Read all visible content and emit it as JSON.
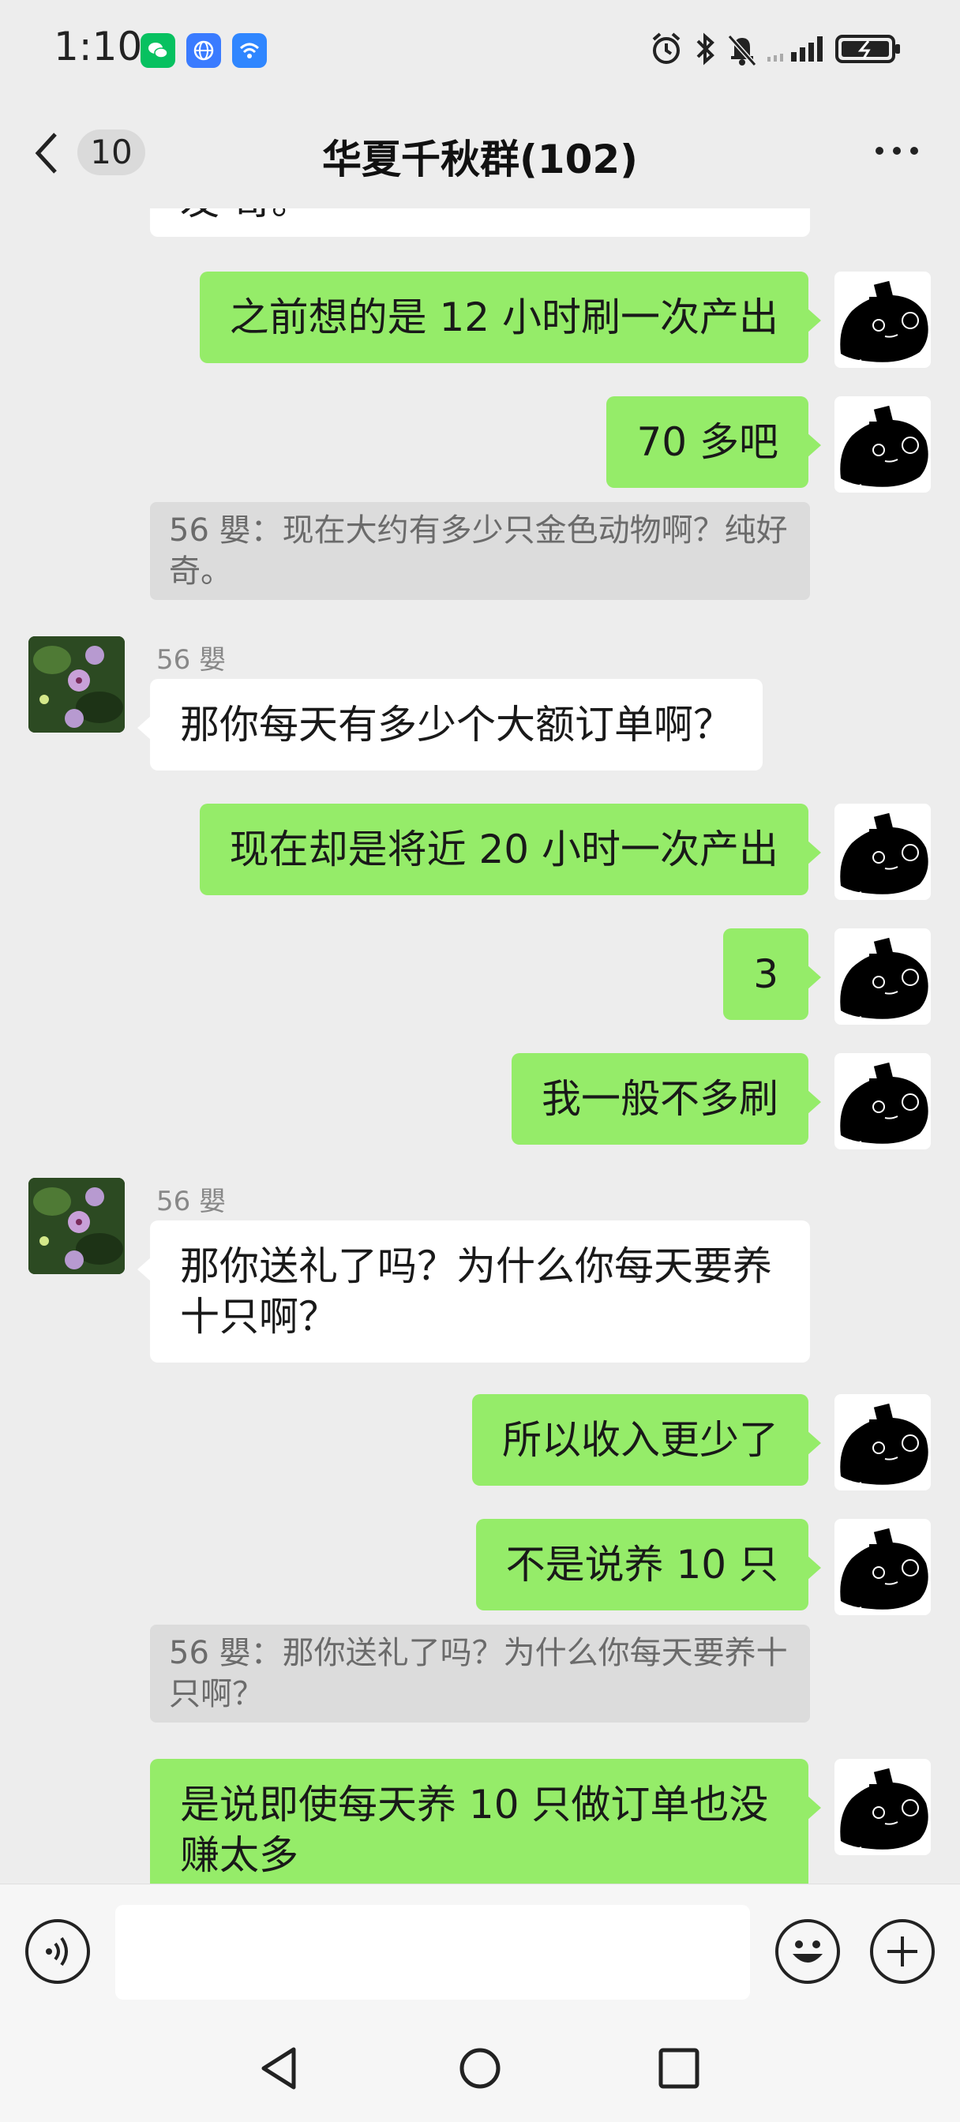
{
  "status_bar": {
    "time": "1:10"
  },
  "header": {
    "back_count": "10",
    "title": "华夏千秋群(102)"
  },
  "messages": [
    {
      "type": "other",
      "text": "发 哥。"
    },
    {
      "type": "me",
      "text": "之前想的是 12 小时刷一次产出"
    },
    {
      "type": "me",
      "text": "70 多吧"
    },
    {
      "type": "quote",
      "text": "56 嬰：现在大约有多少只金色动物啊？纯好奇。"
    },
    {
      "type": "other",
      "sender": "56 嬰",
      "text": "那你每天有多少个大额订单啊？"
    },
    {
      "type": "me",
      "text": "现在却是将近 20 小时一次产出"
    },
    {
      "type": "me",
      "text": "3"
    },
    {
      "type": "me",
      "text": "我一般不多刷"
    },
    {
      "type": "other",
      "sender": "56 嬰",
      "text": "那你送礼了吗？为什么你每天要养十只啊？"
    },
    {
      "type": "me",
      "text": "所以收入更少了"
    },
    {
      "type": "me",
      "text": "不是说养 10 只"
    },
    {
      "type": "quote",
      "text": "56 嬰：那你送礼了吗？为什么你每天要养十只啊？"
    },
    {
      "type": "me",
      "text": "是说即使每天养 10 只做订单也没赚太多"
    }
  ],
  "input": {
    "placeholder": ""
  },
  "icons": {
    "back": "chevron-left-icon",
    "more": "more-dots-icon",
    "voice": "voice-icon",
    "emoji": "emoji-icon",
    "add": "plus-icon",
    "nav_back": "triangle-back-icon",
    "nav_home": "circle-home-icon",
    "nav_recent": "square-recent-icon"
  },
  "colors": {
    "my_bubble": "#95ec69",
    "other_bubble": "#ffffff",
    "background": "#ededed"
  }
}
